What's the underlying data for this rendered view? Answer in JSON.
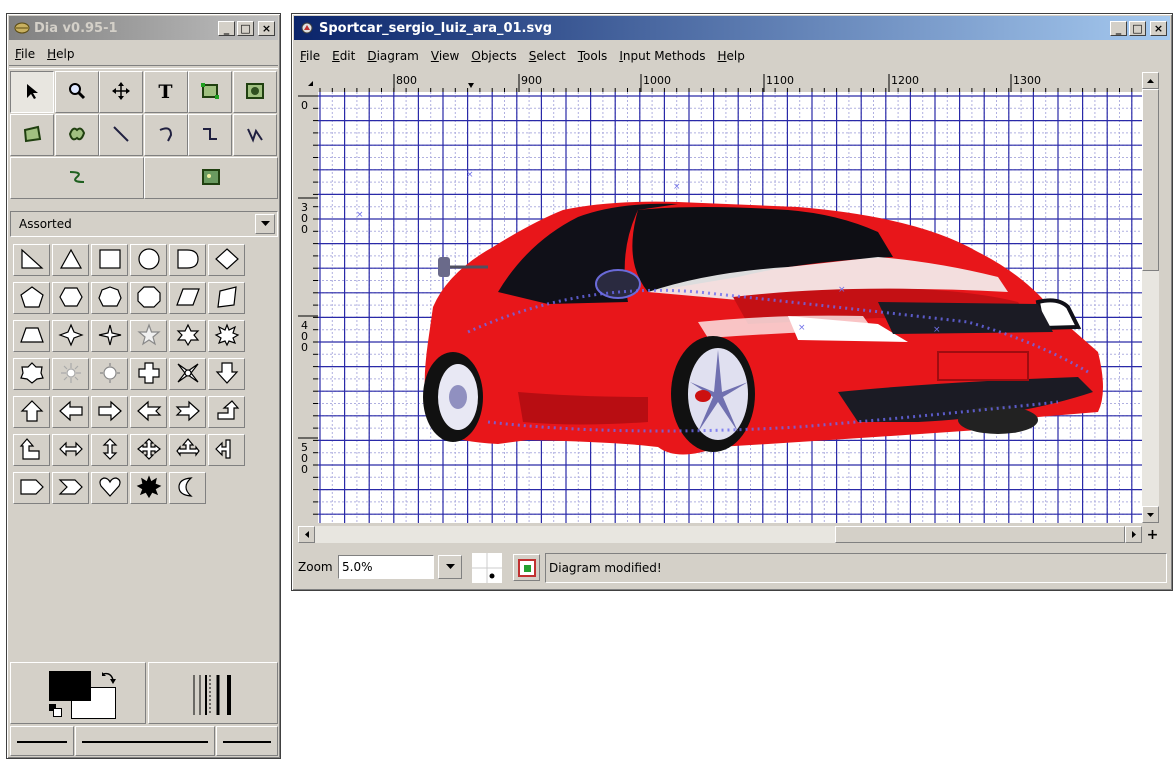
{
  "toolbox": {
    "title": "Dia v0.95-1",
    "menu": [
      "File",
      "Help"
    ],
    "menu_underline": [
      "F",
      "H"
    ],
    "tools": [
      "pointer-tool",
      "magnify-tool",
      "scroll-tool",
      "text-tool",
      "box-tool",
      "ellipse-tool",
      "polygon-tool",
      "beziergon-tool",
      "line-tool",
      "arc-tool",
      "zigzag-tool",
      "polyline-tool",
      "bezier-tool",
      "image-tool"
    ],
    "text_tool_glyph": "T",
    "sheet_selected": "Assorted",
    "shapes": [
      "right-triangle",
      "triangle",
      "square",
      "circle",
      "d-shape",
      "diamond",
      "pentagon",
      "hexagon",
      "heptagon",
      "octagon",
      "parallelogram",
      "quadrilateral",
      "trapezoid",
      "four-point-star",
      "four-point-star-b",
      "five-point-star",
      "six-point-star",
      "burst",
      "seven-point-star",
      "sunburst",
      "sun",
      "plus",
      "ornament",
      "arrow-down",
      "arrow-up",
      "arrow-left",
      "arrow-right",
      "arrow-left-notched",
      "arrow-right-notched",
      "arrow-turn-up",
      "arrow-turn-left",
      "arrow-left-right",
      "arrow-up-down",
      "arrow-four-way",
      "arrow-cross-up",
      "arrow-left-split",
      "pentagon-arrow",
      "chevron",
      "heart",
      "starburst",
      "moon"
    ],
    "fg_color": "#000000",
    "bg_color": "#ffffff"
  },
  "diagram": {
    "title": "Sportcar_sergio_luiz_ara_01.svg",
    "menu": [
      "File",
      "Edit",
      "Diagram",
      "View",
      "Objects",
      "Select",
      "Tools",
      "Input Methods",
      "Help"
    ],
    "menu_underline": [
      "F",
      "E",
      "D",
      "V",
      "O",
      "S",
      "T",
      "I",
      "H"
    ],
    "ruler_h_labels": [
      "800",
      "900",
      "1000",
      "1100",
      "1200",
      "1300"
    ],
    "ruler_v_labels": [
      "0",
      "300",
      "400",
      "500"
    ],
    "zoom_label": "Zoom",
    "zoom_value": "5.0%",
    "status": "Diagram modified!",
    "colors": {
      "grid_major": "#2a2aa8",
      "grid_minor": "#b0b0e0",
      "car_body": "#e8161a",
      "windshield": "#0e0e14"
    }
  }
}
